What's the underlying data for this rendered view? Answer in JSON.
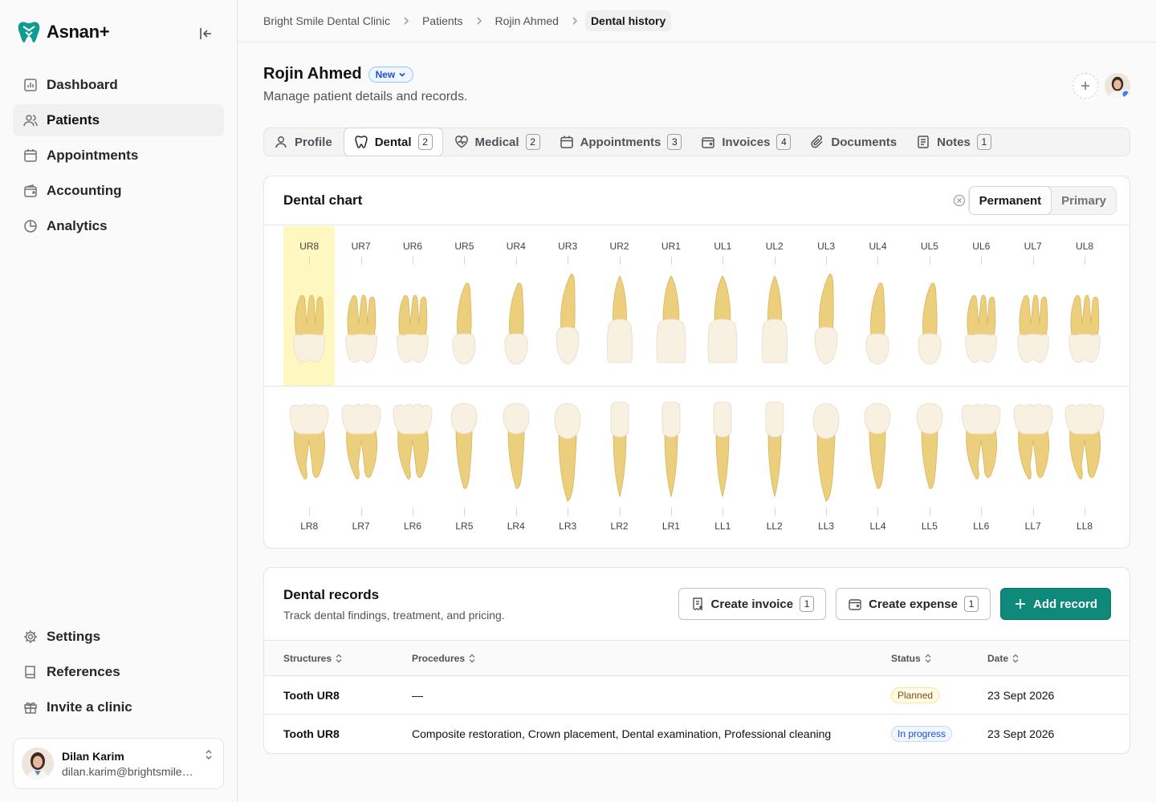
{
  "brand": {
    "name": "Asnan+"
  },
  "sidebar": {
    "nav": [
      {
        "label": "Dashboard",
        "icon": "chart-icon"
      },
      {
        "label": "Patients",
        "icon": "users-icon",
        "active": true
      },
      {
        "label": "Appointments",
        "icon": "calendar-icon"
      },
      {
        "label": "Accounting",
        "icon": "wallet-icon"
      },
      {
        "label": "Analytics",
        "icon": "pie-icon"
      }
    ],
    "bottom": [
      {
        "label": "Settings",
        "icon": "gear-icon"
      },
      {
        "label": "References",
        "icon": "book-icon"
      },
      {
        "label": "Invite a clinic",
        "icon": "gift-icon"
      }
    ],
    "user": {
      "name": "Dilan Karim",
      "email": "dilan.karim@brightsmile.example.com"
    }
  },
  "breadcrumb": [
    "Bright Smile Dental Clinic",
    "Patients",
    "Rojin Ahmed",
    "Dental history"
  ],
  "patient": {
    "name": "Rojin Ahmed",
    "badge": "New",
    "subtitle": "Manage patient details and records."
  },
  "tabs": [
    {
      "label": "Profile",
      "count": null,
      "icon": "user-icon"
    },
    {
      "label": "Dental",
      "count": "2",
      "icon": "tooth-icon",
      "active": true
    },
    {
      "label": "Medical",
      "count": "2",
      "icon": "heart-pulse-icon"
    },
    {
      "label": "Appointments",
      "count": "3",
      "icon": "calendar-icon"
    },
    {
      "label": "Invoices",
      "count": "4",
      "icon": "wallet-icon"
    },
    {
      "label": "Documents",
      "count": null,
      "icon": "paperclip-icon"
    },
    {
      "label": "Notes",
      "count": "1",
      "icon": "note-icon"
    }
  ],
  "dental_chart": {
    "title": "Dental chart",
    "modes": [
      "Permanent",
      "Primary"
    ],
    "active_mode": "Permanent",
    "upper": [
      "UR8",
      "UR7",
      "UR6",
      "UR5",
      "UR4",
      "UR3",
      "UR2",
      "UR1",
      "UL1",
      "UL2",
      "UL3",
      "UL4",
      "UL5",
      "UL6",
      "UL7",
      "UL8"
    ],
    "lower": [
      "LR8",
      "LR7",
      "LR6",
      "LR5",
      "LR4",
      "LR3",
      "LR2",
      "LR1",
      "LL1",
      "LL2",
      "LL3",
      "LL4",
      "LL5",
      "LL6",
      "LL7",
      "LL8"
    ],
    "selected": "UR8",
    "selected_color": "#fef8c0"
  },
  "records": {
    "title": "Dental records",
    "subtitle": "Track dental findings, treatment, and pricing.",
    "actions": {
      "create_invoice": "Create invoice",
      "create_invoice_count": "1",
      "create_expense": "Create expense",
      "create_expense_count": "1",
      "add_record": "Add record"
    },
    "columns": [
      "Structures",
      "Procedures",
      "Status",
      "Date"
    ],
    "rows": [
      {
        "structure": "Tooth UR8",
        "procedures": "—",
        "status": "Planned",
        "date": "23 Sept 2026"
      },
      {
        "structure": "Tooth UR8",
        "procedures": "Composite restoration, Crown placement, Dental examination, Professional cleaning",
        "status": "In progress",
        "date": "23 Sept 2026"
      }
    ]
  },
  "colors": {
    "accent": "#0f8a7a",
    "planned": "#fde68a",
    "in_progress": "#bfdbfe"
  }
}
